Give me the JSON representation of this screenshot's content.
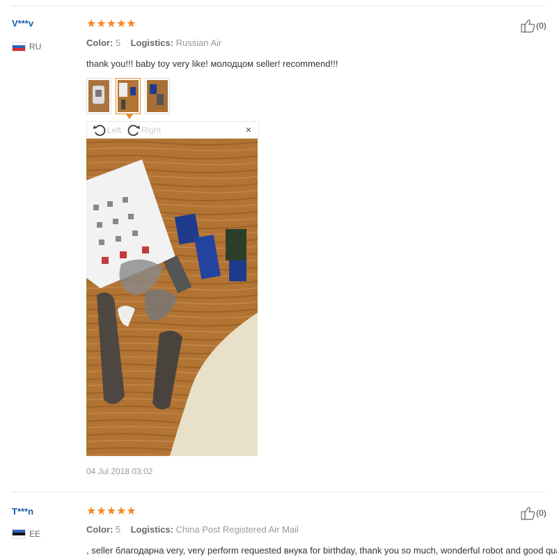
{
  "reviews": [
    {
      "user": "V***v",
      "country": "RU",
      "stars": "★★★★★",
      "color_key": "Color:",
      "color_val": "5",
      "logistics_key": "Logistics:",
      "logistics_val": "Russian Air",
      "text": "thank you!!! baby toy very like! молодцом seller! recommend!!!",
      "helpful": "(0)",
      "date": "04 Jul 2018 03:02",
      "viewer": {
        "left": "Left",
        "right": "Right",
        "close": "×"
      }
    },
    {
      "user": "T***n",
      "country": "EE",
      "stars": "★★★★★",
      "color_key": "Color:",
      "color_val": "5",
      "logistics_key": "Logistics:",
      "logistics_val": "China Post Registered Air Mail",
      "text": ", seller благодарна very, very perform requested внука for birthday, thank you so much, wonderful robot and good quality!",
      "helpful": "(0)"
    }
  ],
  "colors": {
    "username": "#1c5aa8",
    "stars": "#f5861f",
    "active_thumb": "#e48a2c"
  },
  "icons": [
    "thumbs-up-icon",
    "rotate-left-icon",
    "rotate-right-icon",
    "close-icon",
    "flag-ru-icon",
    "flag-ee-icon"
  ]
}
